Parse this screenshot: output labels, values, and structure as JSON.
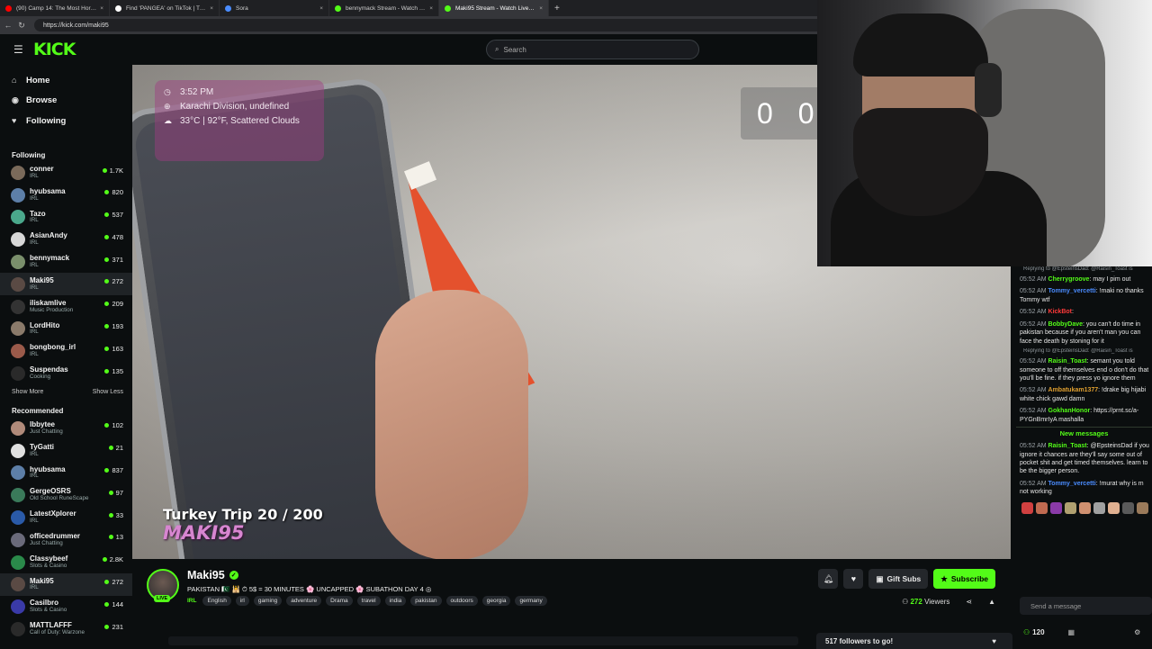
{
  "browser": {
    "tabs": [
      {
        "label": "(90) Camp 14: The Most Horribl",
        "color": "#ff0000"
      },
      {
        "label": "Find 'PANGEA' on TikTok | TikTo",
        "color": "#ffffff"
      },
      {
        "label": "Sora",
        "color": "#4a8cff"
      },
      {
        "label": "bennymack Stream - Watch Live",
        "color": "#53fc18"
      },
      {
        "label": "Maki95 Stream - Watch Live on",
        "color": "#53fc18"
      }
    ],
    "url": "https://kick.com/maki95"
  },
  "header": {
    "logo": "KICK",
    "search_placeholder": "Search"
  },
  "nav": [
    {
      "label": "Home",
      "icon": "home-icon"
    },
    {
      "label": "Browse",
      "icon": "browse-icon"
    },
    {
      "label": "Following",
      "icon": "heart-icon"
    }
  ],
  "following_title": "Following",
  "following": [
    {
      "name": "conner",
      "cat": "IRL",
      "viewers": "1.7K",
      "color": "#7a6a5a"
    },
    {
      "name": "hyubsama",
      "cat": "IRL",
      "viewers": "820",
      "color": "#5d7fa8"
    },
    {
      "name": "Tazo",
      "cat": "IRL",
      "viewers": "537",
      "color": "#4aa88b"
    },
    {
      "name": "AsianAndy",
      "cat": "IRL",
      "viewers": "478",
      "color": "#d7d7d7"
    },
    {
      "name": "bennymack",
      "cat": "IRL",
      "viewers": "371",
      "color": "#7a8f6b"
    },
    {
      "name": "Maki95",
      "cat": "IRL",
      "viewers": "272",
      "color": "#5a4a44"
    },
    {
      "name": "iliskamlive",
      "cat": "Music Production",
      "viewers": "209",
      "color": "#333333"
    },
    {
      "name": "LordHito",
      "cat": "IRL",
      "viewers": "193",
      "color": "#8a7a6a"
    },
    {
      "name": "bongbong_irl",
      "cat": "IRL",
      "viewers": "163",
      "color": "#9a5a4a"
    },
    {
      "name": "Suspendas",
      "cat": "Cooking",
      "viewers": "135",
      "color": "#2a2a2a"
    }
  ],
  "show_more": "Show More",
  "show_less": "Show Less",
  "recommended_title": "Recommended",
  "recommended": [
    {
      "name": "lbbytee",
      "cat": "Just Chatting",
      "viewers": "102",
      "color": "#b08a7a"
    },
    {
      "name": "TyGatti",
      "cat": "IRL",
      "viewers": "21",
      "color": "#e0e0e0"
    },
    {
      "name": "hyubsama",
      "cat": "IRL",
      "viewers": "837",
      "color": "#5d7fa8"
    },
    {
      "name": "GergeOSRS",
      "cat": "Old School RuneScape",
      "viewers": "97",
      "color": "#3a7a5a"
    },
    {
      "name": "LatestXplorer",
      "cat": "IRL",
      "viewers": "33",
      "color": "#2a5aa8"
    },
    {
      "name": "officedrummer",
      "cat": "Just Chatting",
      "viewers": "13",
      "color": "#6a6a7a"
    },
    {
      "name": "Classybeef",
      "cat": "Slots & Casino",
      "viewers": "2.8K",
      "color": "#2a8a4a"
    },
    {
      "name": "Maki95",
      "cat": "IRL",
      "viewers": "272",
      "color": "#5a4a44"
    },
    {
      "name": "Casilbro",
      "cat": "Slots & Casino",
      "viewers": "144",
      "color": "#3a3aa8"
    },
    {
      "name": "MATTLAFFF",
      "cat": "Call of Duty: Warzone",
      "viewers": "231",
      "color": "#2a2a2a"
    }
  ],
  "overlay": {
    "time": "3:52 PM",
    "location": "Karachi Division, undefined",
    "weather": "33°C | 92°F, Scattered Clouds",
    "trip": "Turkey Trip  20 / 200",
    "watermark": "MAKI95",
    "score_left": "0",
    "score_right": "0"
  },
  "chat": {
    "messages": [
      {
        "reply": "Replying to @EpsteinsDad: @Raisin_Toast is",
        "time": "05:52 AM",
        "user": "Cherrygroove",
        "ucolor": "#53fc18",
        "text": ": may I pim out"
      },
      {
        "reply": "",
        "time": "05:52 AM",
        "user": "Tommy_vercetti",
        "ucolor": "#4a8cff",
        "text": ": !maki no thanks Tommy wtf"
      },
      {
        "reply": "",
        "time": "05:52 AM",
        "user": "KickBot",
        "ucolor": "#ff3a3a",
        "text": ":"
      },
      {
        "reply": "",
        "time": "05:52 AM",
        "user": "BobbyDave",
        "ucolor": "#53fc18",
        "text": ": you can't do time in pakistan because if you aren't man you can face the death by stoning for it"
      },
      {
        "reply": "Replying to @EpsteinsDad: @Raisin_Toast is",
        "time": "05:52 AM",
        "user": "Raisin_Toast",
        "ucolor": "#53fc18",
        "text": ": semant you told someone to off themselves end o don't do that you'll be fine. if they press yo ignore them"
      },
      {
        "reply": "",
        "time": "05:52 AM",
        "user": "Ambatukam1377",
        "ucolor": "#e0a030",
        "text": ": !drake big hijabi white chick gawd damn"
      },
      {
        "reply": "",
        "time": "05:52 AM",
        "user": "GokhanHonor",
        "ucolor": "#53fc18",
        "text": ": https://prnt.sc/a-PYGnBmrIyA mashalla"
      }
    ],
    "new_messages": "New messages",
    "after": [
      {
        "time": "05:52 AM",
        "user": "Raisin_Toast",
        "ucolor": "#53fc18",
        "text": ": @EpsteinsDad if you ignore it chances are they'll say some out of pocket shit and get timed themselves. learn to be the bigger person."
      },
      {
        "time": "05:52 AM",
        "user": "Tommy_vercetti",
        "ucolor": "#4a8cff",
        "text": ": !murat why is m not working"
      }
    ],
    "input_placeholder": "Send a message",
    "points": "120"
  },
  "streamer": {
    "name": "Maki95",
    "title": "PAKISTAN 🇵🇰 🕌 ⏱ 5$ = 30 MINUTES 🌸 UNCAPPED 🌸 SUBATHON DAY 4 ◎",
    "category": "IRL",
    "tags": [
      "English",
      "irl",
      "gaming",
      "adventure",
      "Drama",
      "travel",
      "india",
      "pakistan",
      "outdoors",
      "georgia",
      "germany"
    ],
    "gift_subs": "Gift Subs",
    "subscribe": "Subscribe",
    "viewers": "272",
    "viewers_label": "Viewers",
    "live": "LIVE",
    "followers_goal": "517 followers to go!"
  }
}
